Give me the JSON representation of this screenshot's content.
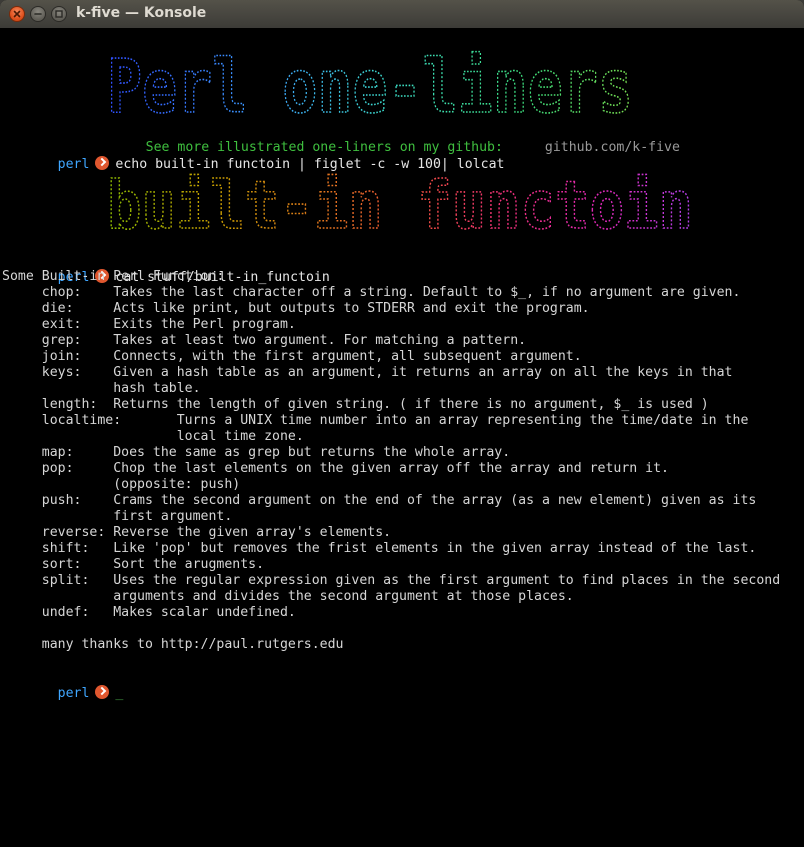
{
  "window": {
    "title": "k-five — Konsole"
  },
  "banner": {
    "title_text": "Perl one-liners",
    "title_colors": [
      "#2f4fff",
      "#3ca0ff",
      "#3ce0c8",
      "#3cdc7a",
      "#7ae050"
    ],
    "github_note": "See more illustrated one-liners on my github:",
    "github_url": "github.com/k-five"
  },
  "prompt_label": "perl",
  "commands": {
    "cmd1": "echo built-in functoin | figlet -c -w 100| lolcat",
    "cmd2": "cat stuff/built-in_functoin"
  },
  "figlet": {
    "text": "built-in functoin",
    "colors": [
      "#8ab800",
      "#c8a000",
      "#e07a1a",
      "#f0503a",
      "#f0307a",
      "#e028b8",
      "#b040e8"
    ]
  },
  "output": {
    "header": "Some Built-in Perl Function:",
    "lines": [
      "    chop:    Takes the last character off a string. Default to $_, if no argument are given.",
      "    die:     Acts like print, but outputs to STDERR and exit the program.",
      "    exit:    Exits the Perl program.",
      "    grep:    Takes at least two argument. For matching a pattern.",
      "    join:    Connects, with the first argument, all subsequent argument.",
      "    keys:    Given a hash table as an argument, it returns an array on all the keys in that",
      "             hash table.",
      "    length:  Returns the length of given string. ( if there is no argument, $_ is used )",
      "    localtime:       Turns a UNIX time number into an array representing the time/date in the",
      "                     local time zone.",
      "    map:     Does the same as grep but returns the whole array.",
      "    pop:     Chop the last elements on the given array off the array and return it.",
      "             (opposite: push)",
      "    push:    Crams the second argument on the end of the array (as a new element) given as its",
      "             first argument.",
      "    reverse: Reverse the given array's elements.",
      "    shift:   Like 'pop' but removes the frist elements in the given array instead of the last.",
      "    sort:    Sort the arugments.",
      "    split:   Uses the regular expression given as the first argument to find places in the second",
      "             arguments and divides the second argument at those places.",
      "    undef:   Makes scalar undefined.",
      "",
      "    many thanks to http://paul.rutgers.edu"
    ]
  },
  "cursor_char": "_"
}
